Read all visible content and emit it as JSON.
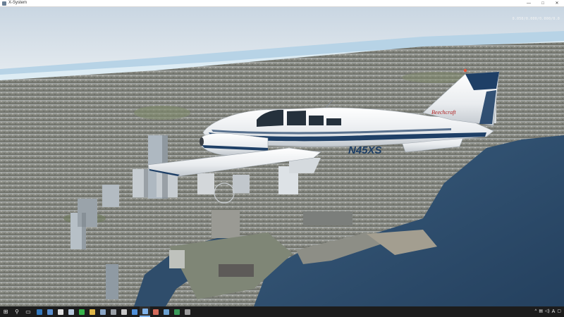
{
  "window": {
    "title": "X-System",
    "minimize": "—",
    "maximize": "□",
    "close": "✕"
  },
  "hud": {
    "fps_text": "0.050/0.000/0.000/0.0"
  },
  "aircraft": {
    "registration": "N45XS",
    "brand": "Beechcraft"
  },
  "taskbar": {
    "start_icon": "windows-logo-icon",
    "search_icon": "search-icon",
    "task_view_icon": "task-view-icon",
    "apps": [
      {
        "icon": "edge-icon",
        "color": "#3277bc"
      },
      {
        "icon": "store-icon",
        "color": "#5a8fd0"
      },
      {
        "icon": "chrome-icon",
        "color": "#e0e0e0"
      },
      {
        "icon": "notepad-icon",
        "color": "#b8c8dc"
      },
      {
        "icon": "spreadsheet-icon",
        "color": "#36b34a"
      },
      {
        "icon": "folder-icon",
        "color": "#e0b748"
      },
      {
        "icon": "photo-icon",
        "color": "#8aa6c6"
      },
      {
        "icon": "settings-icon",
        "color": "#9aa0a6"
      },
      {
        "icon": "media-icon",
        "color": "#c8c8c8"
      },
      {
        "icon": "mail-icon",
        "color": "#4f8fd8"
      },
      {
        "icon": "x-plane-icon",
        "color": "#7fb1e8"
      },
      {
        "icon": "paint-icon",
        "color": "#d46a5a"
      },
      {
        "icon": "game-icon",
        "color": "#6aa0d0"
      },
      {
        "icon": "tool-icon",
        "color": "#3a9a5a"
      },
      {
        "icon": "terminal-icon",
        "color": "#9a9a9a"
      }
    ],
    "tray": {
      "chevron": "^",
      "ime": "A",
      "notification_icon": "notification-icon"
    }
  },
  "colors": {
    "sea": "#2f4f6e",
    "sky": "#cfdbe6",
    "livery_stripe": "#1e3f66"
  }
}
